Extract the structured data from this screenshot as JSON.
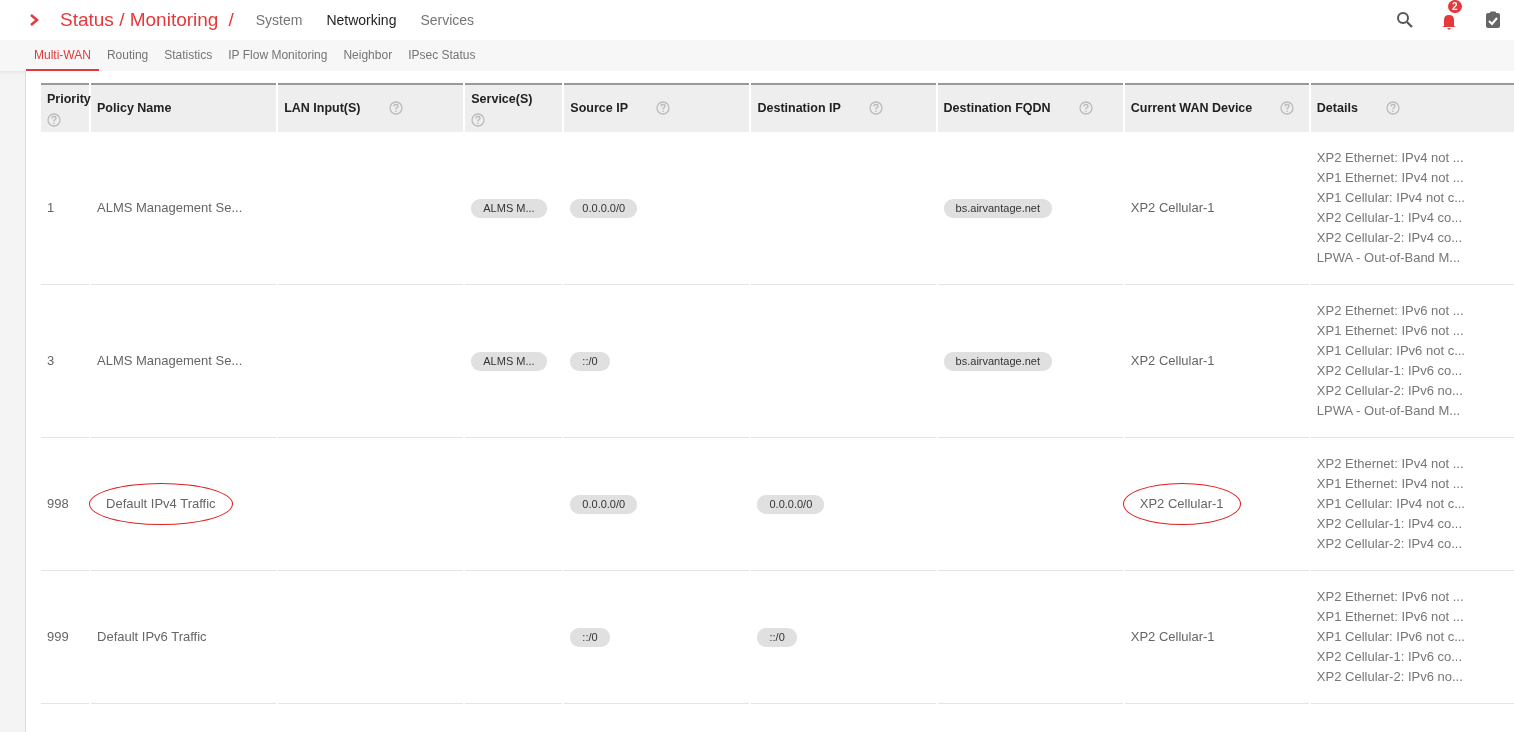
{
  "breadcrumb": {
    "section": "Status / Monitoring",
    "separator": "/"
  },
  "top_tabs": [
    {
      "label": "System",
      "selected": false
    },
    {
      "label": "Networking",
      "selected": true
    },
    {
      "label": "Services",
      "selected": false
    }
  ],
  "notifications": {
    "count": "2"
  },
  "sub_tabs": [
    {
      "label": "Multi-WAN",
      "selected": true
    },
    {
      "label": "Routing",
      "selected": false
    },
    {
      "label": "Statistics",
      "selected": false
    },
    {
      "label": "IP Flow Monitoring",
      "selected": false
    },
    {
      "label": "Neighbor",
      "selected": false
    },
    {
      "label": "IPsec Status",
      "selected": false
    }
  ],
  "table": {
    "columns": [
      "Priority",
      "Policy Name",
      "LAN Input(S)",
      "Service(S)",
      "Source IP",
      "Destination IP",
      "Destination FQDN",
      "Current WAN Device",
      "Details"
    ],
    "rows": [
      {
        "priority": "1",
        "policy_name": "ALMS Management Se...",
        "policy_circled": false,
        "services": [
          "ALMS M..."
        ],
        "source_ip": [
          "0.0.0.0/0"
        ],
        "destination_ip": [],
        "destination_fqdn": [
          "bs.airvantage.net"
        ],
        "current_wan": "XP2 Cellular-1",
        "wan_circled": false,
        "details": [
          "XP2 Ethernet: IPv4 not ...",
          "XP1 Ethernet: IPv4 not ...",
          "XP1 Cellular: IPv4 not c...",
          "XP2 Cellular-1: IPv4 co...",
          "XP2 Cellular-2: IPv4 co...",
          "LPWA - Out-of-Band M..."
        ]
      },
      {
        "priority": "3",
        "policy_name": "ALMS Management Se...",
        "policy_circled": false,
        "services": [
          "ALMS M..."
        ],
        "source_ip": [
          "::/0"
        ],
        "destination_ip": [],
        "destination_fqdn": [
          "bs.airvantage.net"
        ],
        "current_wan": "XP2 Cellular-1",
        "wan_circled": false,
        "details": [
          "XP2 Ethernet: IPv6 not ...",
          "XP1 Ethernet: IPv6 not ...",
          "XP1 Cellular: IPv6 not c...",
          "XP2 Cellular-1: IPv6 co...",
          "XP2 Cellular-2: IPv6 no...",
          "LPWA - Out-of-Band M..."
        ]
      },
      {
        "priority": "998",
        "policy_name": "Default IPv4 Traffic",
        "policy_circled": true,
        "services": [],
        "source_ip": [
          "0.0.0.0/0"
        ],
        "destination_ip": [
          "0.0.0.0/0"
        ],
        "destination_fqdn": [],
        "current_wan": "XP2 Cellular-1",
        "wan_circled": true,
        "details": [
          "XP2 Ethernet: IPv4 not ...",
          "XP1 Ethernet: IPv4 not ...",
          "XP1 Cellular: IPv4 not c...",
          "XP2 Cellular-1: IPv4 co...",
          "XP2 Cellular-2: IPv4 co..."
        ]
      },
      {
        "priority": "999",
        "policy_name": "Default IPv6 Traffic",
        "policy_circled": false,
        "services": [],
        "source_ip": [
          "::/0"
        ],
        "destination_ip": [
          "::/0"
        ],
        "destination_fqdn": [],
        "current_wan": "XP2 Cellular-1",
        "wan_circled": false,
        "details": [
          "XP2 Ethernet: IPv6 not ...",
          "XP1 Ethernet: IPv6 not ...",
          "XP1 Cellular: IPv6 not c...",
          "XP2 Cellular-1: IPv6 co...",
          "XP2 Cellular-2: IPv6 no..."
        ]
      }
    ]
  }
}
